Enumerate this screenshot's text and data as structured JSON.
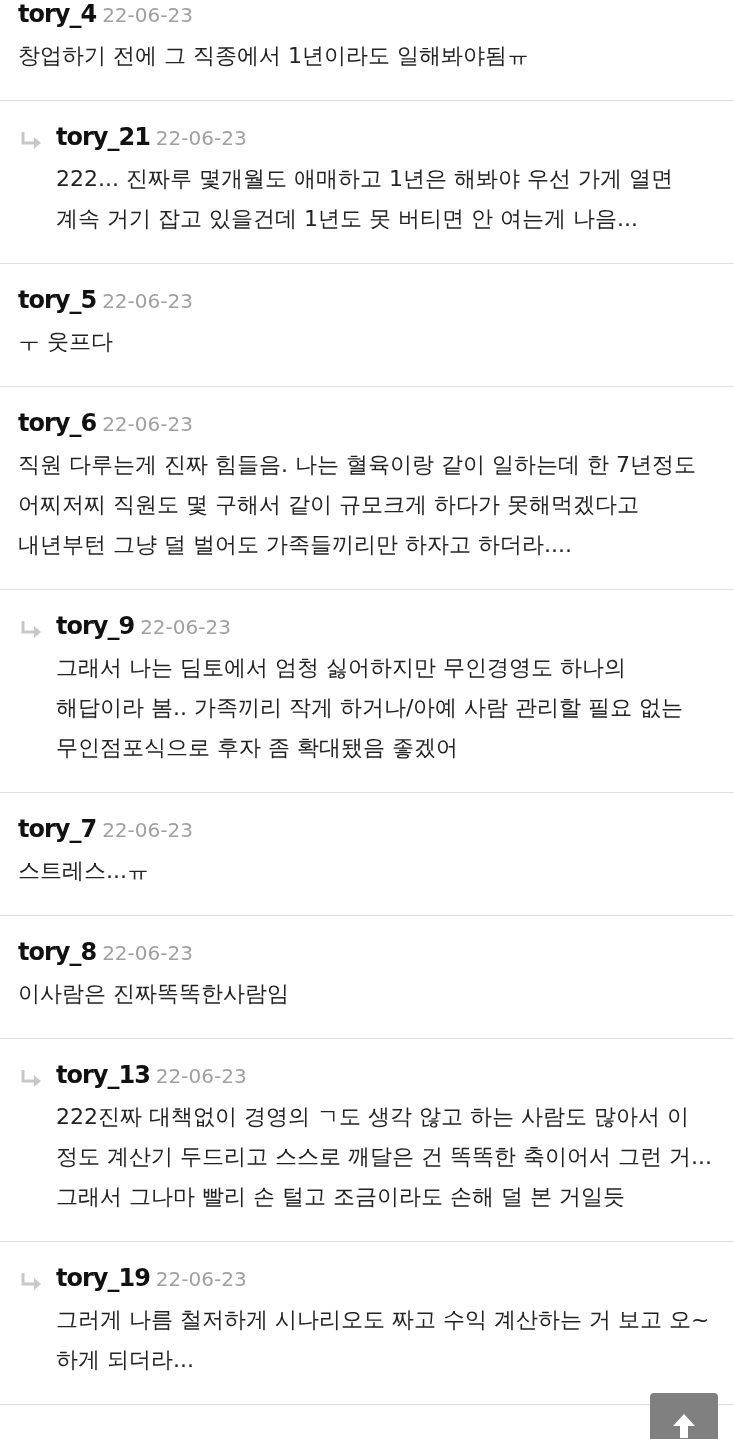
{
  "comments": [
    {
      "kind": "comment",
      "author": "tory_4",
      "date": "22-06-23",
      "text": "창업하기 전에 그 직종에서 1년이라도 일해봐야됨ㅠ"
    },
    {
      "kind": "reply",
      "author": "tory_21",
      "date": "22-06-23",
      "text": "222... 진짜루 몇개월도 애매하고 1년은 해봐야 우선 가게 열면 계속 거기 잡고 있을건데 1년도 못 버티면 안 여는게 나음..."
    },
    {
      "kind": "comment",
      "author": "tory_5",
      "date": "22-06-23",
      "text": "ㅜ 웃프다"
    },
    {
      "kind": "comment",
      "author": "tory_6",
      "date": "22-06-23",
      "text": "직원 다루는게 진짜 힘들음. 나는 혈육이랑 같이 일하는데 한 7년정도 어찌저찌 직원도 몇 구해서 같이 규모크게 하다가 못해먹겠다고 내년부턴 그냥 덜 벌어도 가족들끼리만 하자고 하더라...."
    },
    {
      "kind": "reply",
      "author": "tory_9",
      "date": "22-06-23",
      "text": "그래서 나는 딤토에서 엄청 싫어하지만 무인경영도 하나의 해답이라 봄.. 가족끼리 작게 하거나/아예 사람 관리할 필요 없는 무인점포식으로 후자 좀 확대됐음 좋겠어"
    },
    {
      "kind": "comment",
      "author": "tory_7",
      "date": "22-06-23",
      "text": "스트레스...ㅠ"
    },
    {
      "kind": "comment",
      "author": "tory_8",
      "date": "22-06-23",
      "text": "이사람은 진짜똑똑한사람임"
    },
    {
      "kind": "reply",
      "author": "tory_13",
      "date": "22-06-23",
      "text": "222진짜 대책없이 경영의 ㄱ도 생각 않고 하는 사람도 많아서 이 정도 계산기 두드리고 스스로 깨달은 건 똑똑한 축이어서 그런 거...그래서 그나마 빨리 손 털고 조금이라도 손해 덜 본 거일듯"
    },
    {
      "kind": "reply",
      "author": "tory_19",
      "date": "22-06-23",
      "text": "그러게 나름 철저하게 시나리오도 짜고 수익 계산하는 거 보고 오~ 하게 되더라..."
    }
  ]
}
